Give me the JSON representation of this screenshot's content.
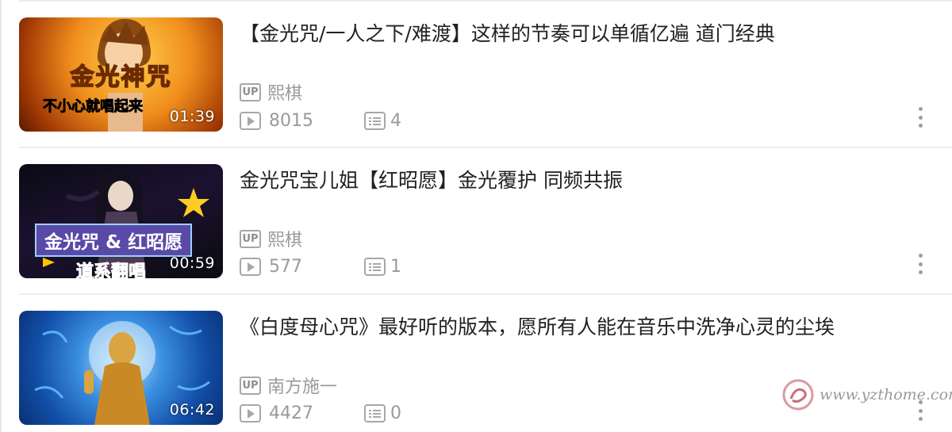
{
  "videos": [
    {
      "title": "【金光咒/一人之下/难渡】这样的节奏可以单循亿遍 道门经典",
      "uploader": "熙棋",
      "views": "8015",
      "comments": "4",
      "duration": "01:39",
      "thumb_text": [
        "金光神咒",
        "不小心就唱起来"
      ]
    },
    {
      "title": "金光咒宝儿姐【红昭愿】金光覆护 同频共振",
      "uploader": "熙棋",
      "views": "577",
      "comments": "1",
      "duration": "00:59",
      "thumb_text": [
        "金光咒 & 红昭愿",
        "道系翻唱"
      ]
    },
    {
      "title": "《白度母心咒》最好听的版本，愿所有人能在音乐中洗净心灵的尘埃",
      "uploader": "南方施一",
      "views": "4427",
      "comments": "0",
      "duration": "06:42"
    }
  ],
  "up_badge": "UP",
  "watermark": "www.yzthome.com",
  "icons": {
    "uploader": "up-badge-icon",
    "views": "play-icon",
    "comments": "list-icon",
    "menu": "more-vertical-icon"
  },
  "colors": {
    "text": "#212121",
    "meta": "#9a9a9a",
    "separator": "#ececec"
  }
}
